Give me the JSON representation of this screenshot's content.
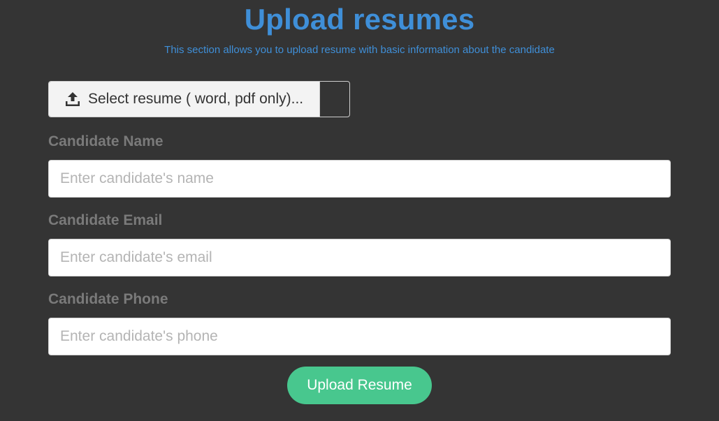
{
  "header": {
    "title": "Upload resumes",
    "subtitle": "This section allows you to upload resume with basic information about the candidate"
  },
  "file_picker": {
    "label": "Select resume ( word, pdf only)...",
    "icon": "upload-icon"
  },
  "fields": {
    "name": {
      "label": "Candidate Name",
      "placeholder": "Enter candidate's name",
      "value": ""
    },
    "email": {
      "label": "Candidate Email",
      "placeholder": "Enter candidate's email",
      "value": ""
    },
    "phone": {
      "label": "Candidate Phone",
      "placeholder": "Enter candidate's phone",
      "value": ""
    }
  },
  "submit": {
    "label": "Upload Resume"
  },
  "colors": {
    "background": "#343434",
    "accent": "#3f8fd8",
    "button": "#48c78e",
    "label": "#7a7a7a"
  }
}
